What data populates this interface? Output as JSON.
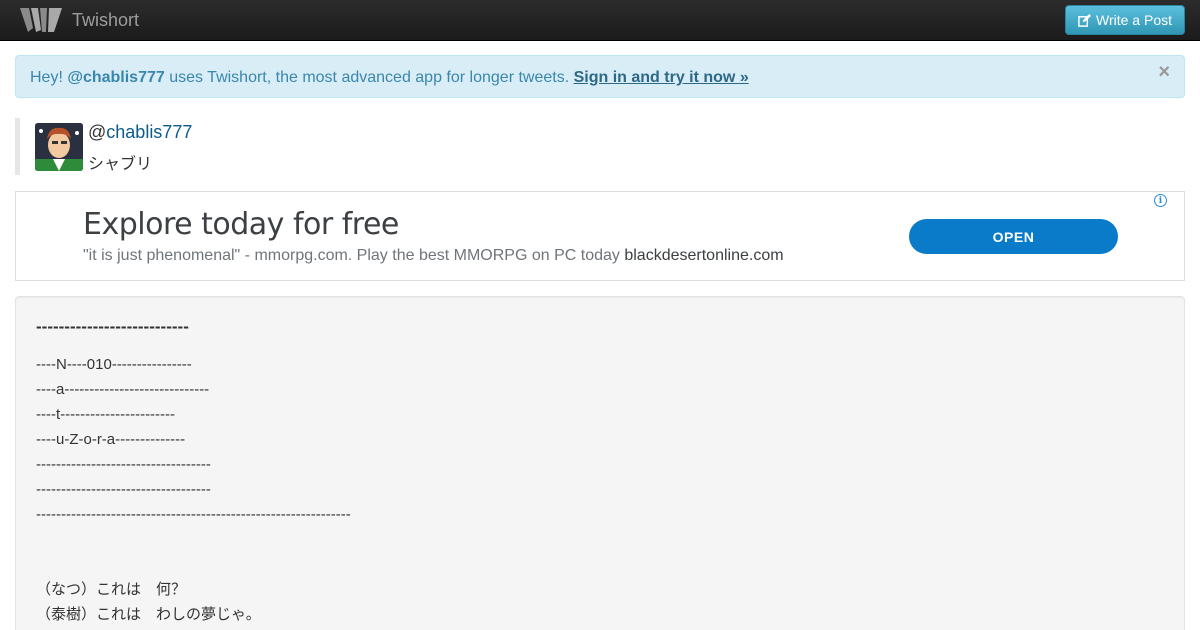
{
  "navbar": {
    "app_name": "Twishort",
    "logo_icon": "twishort-logo-icon",
    "write_button_label": "Write a Post",
    "write_button_icon": "edit-icon"
  },
  "alert": {
    "prefix": "Hey! ",
    "username": "@chablis777",
    "message": " uses Twishort, the most advanced app for longer tweets. ",
    "link_text": "Sign in and try it now »",
    "close_label": "×"
  },
  "profile": {
    "at": "@",
    "username": "chablis777",
    "display_name": "シャブリ"
  },
  "ad": {
    "title": "Explore today for free",
    "description": "\"it is just phenomenal\" - mmorpg.com. Play the best MMORPG on PC today ",
    "domain": "blackdesertonline.com",
    "button_label": "OPEN",
    "info_label": "i"
  },
  "post": {
    "title": "---------------------------",
    "lines": [
      "----N----010----------------",
      "----a-----------------------------",
      "----t-----------------------",
      "----u-Z-o-r-a--------------",
      "-----------------------------------",
      "-----------------------------------",
      "---------------------------------------------------------------",
      "",
      "",
      "（なつ）これは　何？",
      "（泰樹）これは　わしの夢じゃ。"
    ]
  },
  "colors": {
    "navbar_bg": "#222222",
    "button_info": "#49afcd",
    "alert_bg": "#d9edf7",
    "alert_text": "#3a87ad",
    "ad_button": "#0a7bc8",
    "post_bg": "#f5f5f5"
  }
}
